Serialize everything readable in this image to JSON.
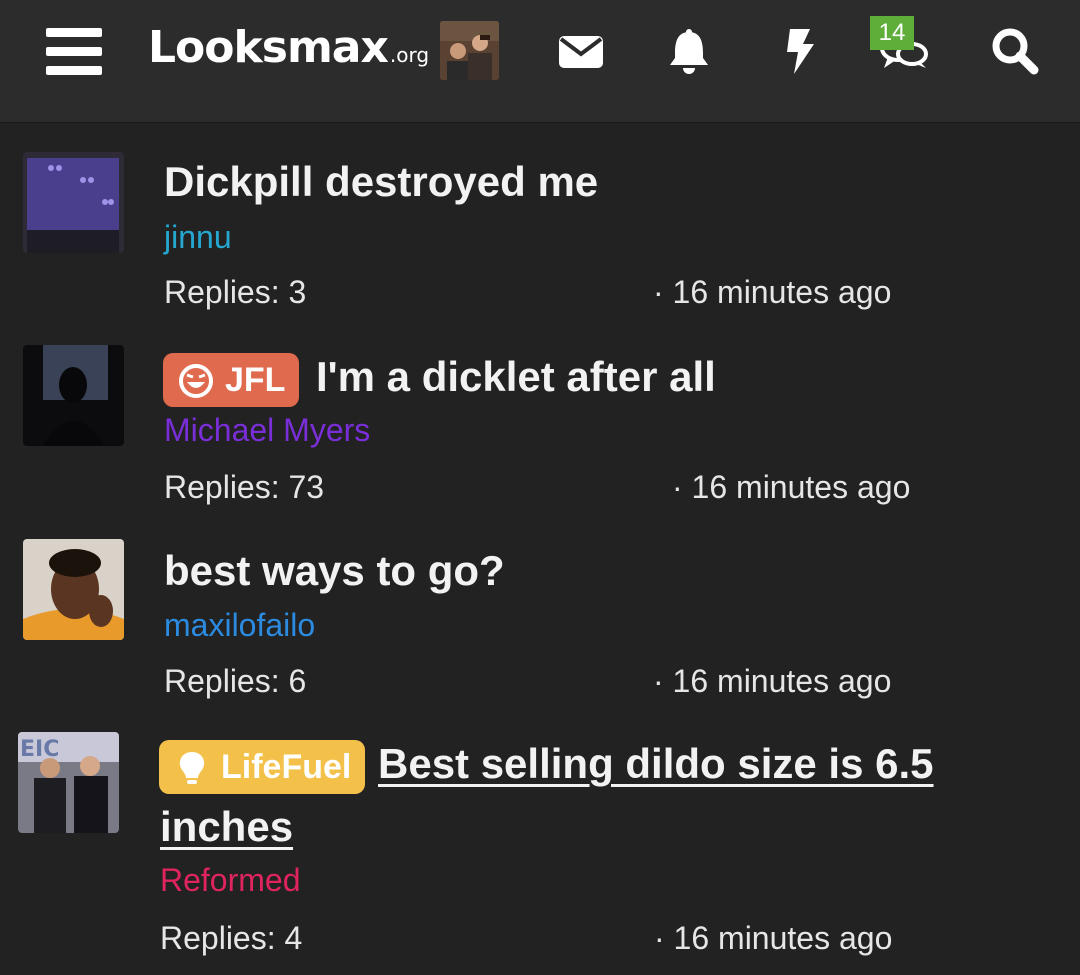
{
  "header": {
    "logo_main": "Looksmax",
    "logo_suffix": ".org",
    "alerts_badge": "14",
    "icons": [
      "menu-icon",
      "envelope-icon",
      "bell-icon",
      "lightning-icon",
      "chat-icon",
      "search-icon"
    ]
  },
  "threads": [
    {
      "title": "Dickpill destroyed me",
      "prefix": "",
      "author": "jinnu",
      "author_color": "#25a7d0",
      "replies": "Replies: 3",
      "time": "· 16 minutes ago"
    },
    {
      "title": "I'm a dicklet after all",
      "prefix": "JFL",
      "prefix_color": "#e06a4d",
      "author": "Michael Myers",
      "author_color": "#7a2ed8",
      "replies": "Replies: 73",
      "time": "· 16 minutes ago"
    },
    {
      "title": "best ways to go?",
      "prefix": "",
      "author": "maxilofailo",
      "author_color": "#2b8be0",
      "replies": "Replies: 6",
      "time": "· 16 minutes ago"
    },
    {
      "title_line1": "Best selling dildo size is 6.5",
      "title_line2": "inches",
      "prefix": "LifeFuel",
      "prefix_color": "#f3c04a",
      "author": "Reformed",
      "author_color": "#e0245e",
      "replies": "Replies: 4",
      "time": "· 16 minutes ago"
    }
  ]
}
